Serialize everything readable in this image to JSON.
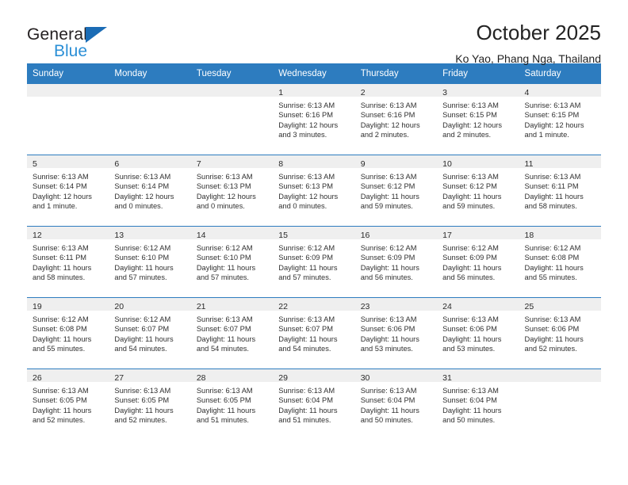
{
  "brand": {
    "line1": "General",
    "line2": "Blue",
    "triangle_color": "#1b6cb5",
    "blue_text_color": "#2b8fd6"
  },
  "header": {
    "title": "October 2025",
    "subtitle": "Ko Yao, Phang Nga, Thailand"
  },
  "theme": {
    "header_blue": "#2d7cbf",
    "day_band_gray": "#efefef",
    "text": "#303030"
  },
  "calendar": {
    "weekdays": [
      "Sunday",
      "Monday",
      "Tuesday",
      "Wednesday",
      "Thursday",
      "Friday",
      "Saturday"
    ],
    "weeks": [
      [
        {
          "day": "",
          "empty": true
        },
        {
          "day": "",
          "empty": true
        },
        {
          "day": "",
          "empty": true
        },
        {
          "day": "1",
          "sunrise": "Sunrise: 6:13 AM",
          "sunset": "Sunset: 6:16 PM",
          "daylight1": "Daylight: 12 hours",
          "daylight2": "and 3 minutes."
        },
        {
          "day": "2",
          "sunrise": "Sunrise: 6:13 AM",
          "sunset": "Sunset: 6:16 PM",
          "daylight1": "Daylight: 12 hours",
          "daylight2": "and 2 minutes."
        },
        {
          "day": "3",
          "sunrise": "Sunrise: 6:13 AM",
          "sunset": "Sunset: 6:15 PM",
          "daylight1": "Daylight: 12 hours",
          "daylight2": "and 2 minutes."
        },
        {
          "day": "4",
          "sunrise": "Sunrise: 6:13 AM",
          "sunset": "Sunset: 6:15 PM",
          "daylight1": "Daylight: 12 hours",
          "daylight2": "and 1 minute."
        }
      ],
      [
        {
          "day": "5",
          "sunrise": "Sunrise: 6:13 AM",
          "sunset": "Sunset: 6:14 PM",
          "daylight1": "Daylight: 12 hours",
          "daylight2": "and 1 minute."
        },
        {
          "day": "6",
          "sunrise": "Sunrise: 6:13 AM",
          "sunset": "Sunset: 6:14 PM",
          "daylight1": "Daylight: 12 hours",
          "daylight2": "and 0 minutes."
        },
        {
          "day": "7",
          "sunrise": "Sunrise: 6:13 AM",
          "sunset": "Sunset: 6:13 PM",
          "daylight1": "Daylight: 12 hours",
          "daylight2": "and 0 minutes."
        },
        {
          "day": "8",
          "sunrise": "Sunrise: 6:13 AM",
          "sunset": "Sunset: 6:13 PM",
          "daylight1": "Daylight: 12 hours",
          "daylight2": "and 0 minutes."
        },
        {
          "day": "9",
          "sunrise": "Sunrise: 6:13 AM",
          "sunset": "Sunset: 6:12 PM",
          "daylight1": "Daylight: 11 hours",
          "daylight2": "and 59 minutes."
        },
        {
          "day": "10",
          "sunrise": "Sunrise: 6:13 AM",
          "sunset": "Sunset: 6:12 PM",
          "daylight1": "Daylight: 11 hours",
          "daylight2": "and 59 minutes."
        },
        {
          "day": "11",
          "sunrise": "Sunrise: 6:13 AM",
          "sunset": "Sunset: 6:11 PM",
          "daylight1": "Daylight: 11 hours",
          "daylight2": "and 58 minutes."
        }
      ],
      [
        {
          "day": "12",
          "sunrise": "Sunrise: 6:13 AM",
          "sunset": "Sunset: 6:11 PM",
          "daylight1": "Daylight: 11 hours",
          "daylight2": "and 58 minutes."
        },
        {
          "day": "13",
          "sunrise": "Sunrise: 6:12 AM",
          "sunset": "Sunset: 6:10 PM",
          "daylight1": "Daylight: 11 hours",
          "daylight2": "and 57 minutes."
        },
        {
          "day": "14",
          "sunrise": "Sunrise: 6:12 AM",
          "sunset": "Sunset: 6:10 PM",
          "daylight1": "Daylight: 11 hours",
          "daylight2": "and 57 minutes."
        },
        {
          "day": "15",
          "sunrise": "Sunrise: 6:12 AM",
          "sunset": "Sunset: 6:09 PM",
          "daylight1": "Daylight: 11 hours",
          "daylight2": "and 57 minutes."
        },
        {
          "day": "16",
          "sunrise": "Sunrise: 6:12 AM",
          "sunset": "Sunset: 6:09 PM",
          "daylight1": "Daylight: 11 hours",
          "daylight2": "and 56 minutes."
        },
        {
          "day": "17",
          "sunrise": "Sunrise: 6:12 AM",
          "sunset": "Sunset: 6:09 PM",
          "daylight1": "Daylight: 11 hours",
          "daylight2": "and 56 minutes."
        },
        {
          "day": "18",
          "sunrise": "Sunrise: 6:12 AM",
          "sunset": "Sunset: 6:08 PM",
          "daylight1": "Daylight: 11 hours",
          "daylight2": "and 55 minutes."
        }
      ],
      [
        {
          "day": "19",
          "sunrise": "Sunrise: 6:12 AM",
          "sunset": "Sunset: 6:08 PM",
          "daylight1": "Daylight: 11 hours",
          "daylight2": "and 55 minutes."
        },
        {
          "day": "20",
          "sunrise": "Sunrise: 6:12 AM",
          "sunset": "Sunset: 6:07 PM",
          "daylight1": "Daylight: 11 hours",
          "daylight2": "and 54 minutes."
        },
        {
          "day": "21",
          "sunrise": "Sunrise: 6:13 AM",
          "sunset": "Sunset: 6:07 PM",
          "daylight1": "Daylight: 11 hours",
          "daylight2": "and 54 minutes."
        },
        {
          "day": "22",
          "sunrise": "Sunrise: 6:13 AM",
          "sunset": "Sunset: 6:07 PM",
          "daylight1": "Daylight: 11 hours",
          "daylight2": "and 54 minutes."
        },
        {
          "day": "23",
          "sunrise": "Sunrise: 6:13 AM",
          "sunset": "Sunset: 6:06 PM",
          "daylight1": "Daylight: 11 hours",
          "daylight2": "and 53 minutes."
        },
        {
          "day": "24",
          "sunrise": "Sunrise: 6:13 AM",
          "sunset": "Sunset: 6:06 PM",
          "daylight1": "Daylight: 11 hours",
          "daylight2": "and 53 minutes."
        },
        {
          "day": "25",
          "sunrise": "Sunrise: 6:13 AM",
          "sunset": "Sunset: 6:06 PM",
          "daylight1": "Daylight: 11 hours",
          "daylight2": "and 52 minutes."
        }
      ],
      [
        {
          "day": "26",
          "sunrise": "Sunrise: 6:13 AM",
          "sunset": "Sunset: 6:05 PM",
          "daylight1": "Daylight: 11 hours",
          "daylight2": "and 52 minutes."
        },
        {
          "day": "27",
          "sunrise": "Sunrise: 6:13 AM",
          "sunset": "Sunset: 6:05 PM",
          "daylight1": "Daylight: 11 hours",
          "daylight2": "and 52 minutes."
        },
        {
          "day": "28",
          "sunrise": "Sunrise: 6:13 AM",
          "sunset": "Sunset: 6:05 PM",
          "daylight1": "Daylight: 11 hours",
          "daylight2": "and 51 minutes."
        },
        {
          "day": "29",
          "sunrise": "Sunrise: 6:13 AM",
          "sunset": "Sunset: 6:04 PM",
          "daylight1": "Daylight: 11 hours",
          "daylight2": "and 51 minutes."
        },
        {
          "day": "30",
          "sunrise": "Sunrise: 6:13 AM",
          "sunset": "Sunset: 6:04 PM",
          "daylight1": "Daylight: 11 hours",
          "daylight2": "and 50 minutes."
        },
        {
          "day": "31",
          "sunrise": "Sunrise: 6:13 AM",
          "sunset": "Sunset: 6:04 PM",
          "daylight1": "Daylight: 11 hours",
          "daylight2": "and 50 minutes."
        },
        {
          "day": "",
          "empty": true
        }
      ]
    ]
  }
}
